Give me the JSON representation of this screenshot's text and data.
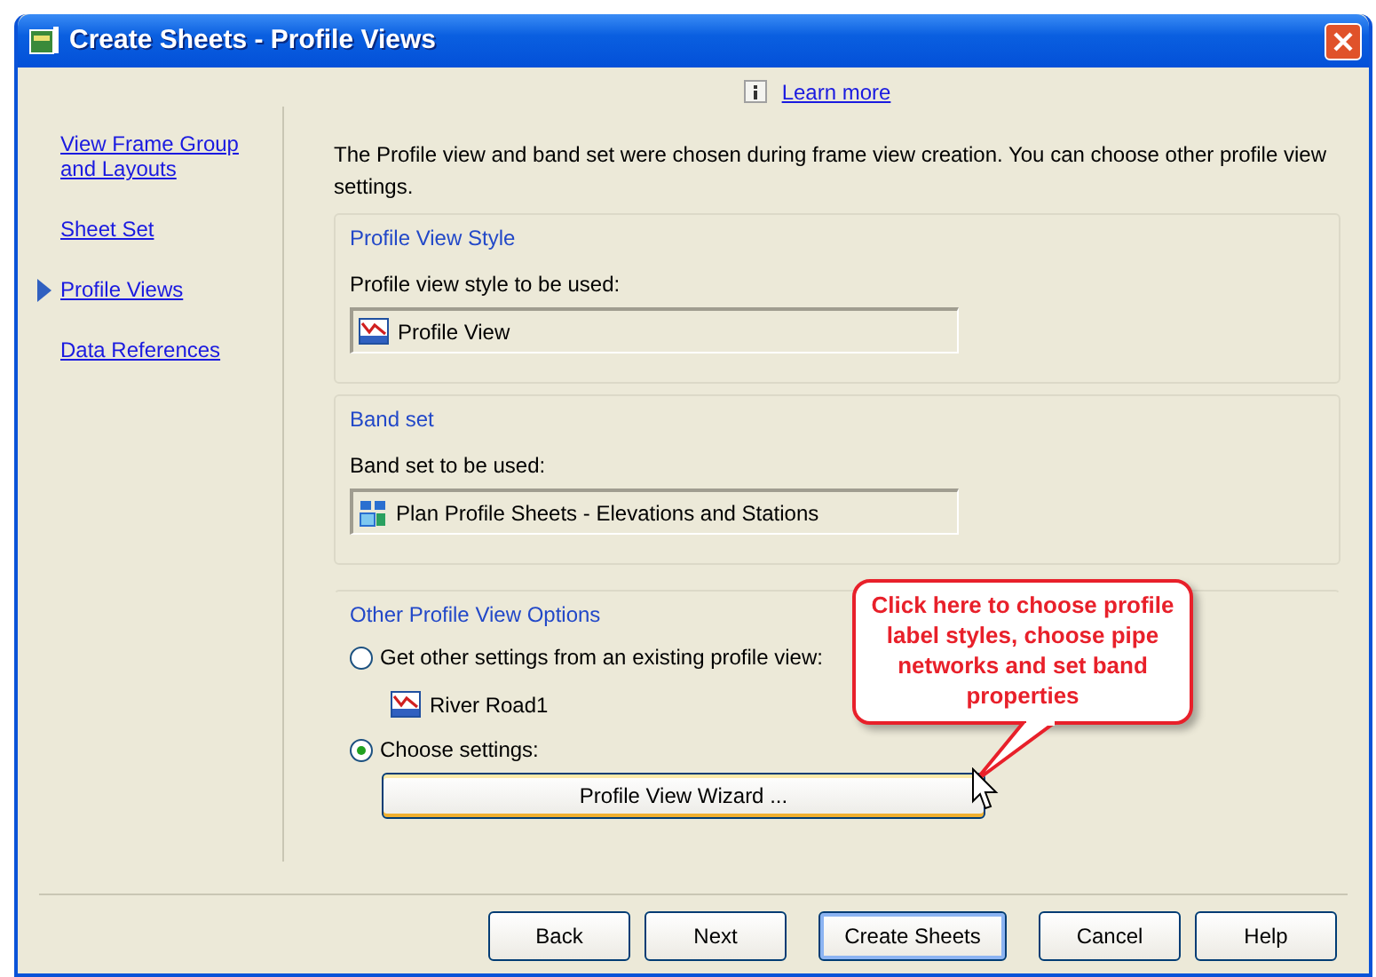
{
  "window": {
    "title": "Create Sheets - Profile Views"
  },
  "learn_more": "Learn more",
  "nav": [
    {
      "label": "View Frame Group and Layouts",
      "selected": false
    },
    {
      "label": "Sheet Set",
      "selected": false
    },
    {
      "label": "Profile Views",
      "selected": true
    },
    {
      "label": "Data References",
      "selected": false
    }
  ],
  "description": "The Profile view and band set were chosen during frame view creation. You can choose other profile view settings.",
  "sections": [
    {
      "title": "Profile View Style",
      "field_label": "Profile view style to be used:",
      "value": "Profile View",
      "kind": "style"
    },
    {
      "title": "Band set",
      "field_label": "Band set to be used:",
      "value": "Plan Profile Sheets - Elevations and Stations",
      "kind": "band"
    }
  ],
  "other_options": {
    "title": "Other Profile View Options",
    "options": [
      {
        "label": "Get other settings from an existing profile view:",
        "selected": false,
        "value": "River Road1"
      },
      {
        "label": "Choose settings:",
        "selected": true
      }
    ],
    "wizard_button": "Profile View Wizard ..."
  },
  "callout": "Click here to choose profile label styles, choose pipe networks and set band properties",
  "buttons": [
    {
      "label": "Back",
      "default": false
    },
    {
      "label": "Next",
      "default": false
    },
    {
      "label": "Create Sheets",
      "default": true
    },
    {
      "label": "Cancel",
      "default": false
    },
    {
      "label": "Help",
      "default": false
    }
  ]
}
